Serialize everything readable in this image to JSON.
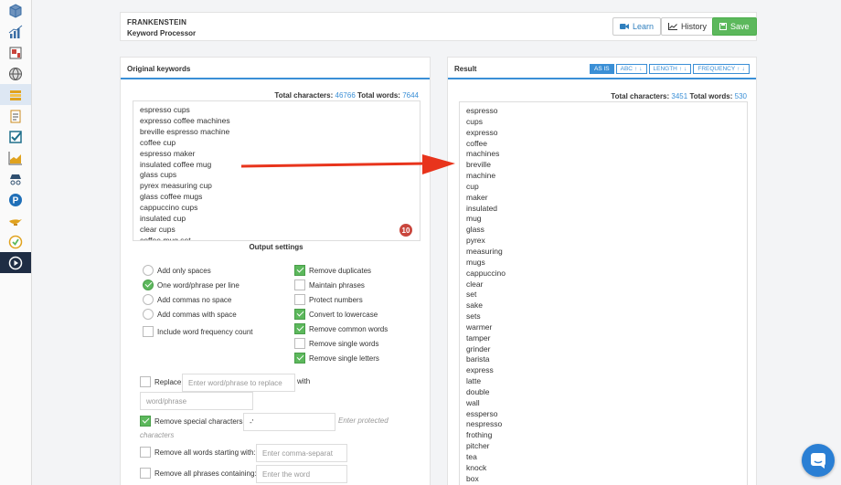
{
  "app_rail": [
    {
      "icon": "cube-icon",
      "color": "#3b6ea5"
    },
    {
      "icon": "bar-chart-icon",
      "color": "#3b6ea5"
    },
    {
      "icon": "report-icon",
      "color": "#c9463d"
    },
    {
      "icon": "globe-icon",
      "color": "#555555"
    },
    {
      "icon": "keyword-processor-icon",
      "color": "#e0a21e"
    },
    {
      "icon": "clipboard-icon",
      "color": "#c98a1e"
    },
    {
      "icon": "checklist-icon",
      "color": "#1f6f8b"
    },
    {
      "icon": "area-chart-icon",
      "color": "#e0a21e"
    },
    {
      "icon": "spy-icon",
      "color": "#2f4f6f"
    },
    {
      "icon": "parking-icon",
      "color": "#1f6fb8"
    },
    {
      "icon": "genie-lamp-icon",
      "color": "#e0a21e"
    },
    {
      "icon": "badge-check-icon",
      "color": "#e0a21e"
    },
    {
      "icon": "play-circle-icon",
      "color": "#ffffff"
    }
  ],
  "header": {
    "title": "FRANKENSTEIN",
    "subtitle": "Keyword Processor",
    "learn_label": "Learn",
    "history_label": "History",
    "save_label": "Save"
  },
  "original": {
    "panel_title": "Original keywords",
    "total_chars_label": "Total characters:",
    "total_chars": "46766",
    "total_words_label": "Total words:",
    "total_words": "7644",
    "keywords": [
      "espresso cups",
      "expresso coffee machines",
      "breville espresso machine",
      "coffee cup",
      "espresso maker",
      "insulated coffee mug",
      "glass cups",
      "pyrex measuring cup",
      "glass coffee mugs",
      "cappuccino cups",
      "insulated cup",
      "clear cups",
      "coffee mug set"
    ],
    "grammar_badge": "10"
  },
  "output_settings": {
    "title": "Output settings",
    "radios": [
      {
        "label": "Add only spaces",
        "checked": false
      },
      {
        "label": "One word/phrase per line",
        "checked": true
      },
      {
        "label": "Add commas no space",
        "checked": false
      },
      {
        "label": "Add commas with space",
        "checked": false
      }
    ],
    "freq_label": "Include word frequency count",
    "checkboxes": [
      {
        "label": "Remove duplicates",
        "checked": true
      },
      {
        "label": "Maintain phrases",
        "checked": false
      },
      {
        "label": "Protect numbers",
        "checked": false
      },
      {
        "label": "Convert to lowercase",
        "checked": true
      },
      {
        "label": "Remove common words",
        "checked": true
      },
      {
        "label": "Remove single words",
        "checked": false
      },
      {
        "label": "Remove single letters",
        "checked": true
      }
    ],
    "replace_label": "Replace",
    "replace_placeholder": "Enter word/phrase to replace",
    "with_label": "with",
    "with_placeholder": "word/phrase",
    "special_label": "Remove special characters:",
    "special_value": "-'",
    "protected_hint_1": "Enter protected",
    "protected_hint_2": "characters",
    "starting_label": "Remove all words starting with:",
    "starting_placeholder": "Enter comma-separat",
    "containing_label": "Remove all phrases containing:",
    "containing_placeholder": "Enter the word"
  },
  "result": {
    "panel_title": "Result",
    "sort": [
      {
        "label": "AS IS",
        "active": true,
        "arrows": false
      },
      {
        "label": "ABC",
        "active": false,
        "arrows": true
      },
      {
        "label": "LENGTH",
        "active": false,
        "arrows": true
      },
      {
        "label": "FREQUENCY",
        "active": false,
        "arrows": true
      }
    ],
    "total_chars_label": "Total characters:",
    "total_chars": "3451",
    "total_words_label": "Total words:",
    "total_words": "530",
    "words": [
      "espresso",
      "cups",
      "expresso",
      "coffee",
      "machines",
      "breville",
      "machine",
      "cup",
      "maker",
      "insulated",
      "mug",
      "glass",
      "pyrex",
      "measuring",
      "mugs",
      "cappuccino",
      "clear",
      "set",
      "sake",
      "sets",
      "warmer",
      "tamper",
      "grinder",
      "barista",
      "express",
      "latte",
      "double",
      "wall",
      "essperso",
      "nespresso",
      "frothing",
      "pitcher",
      "tea",
      "knock",
      "box"
    ]
  },
  "colors": {
    "accent": "#3a8fd6",
    "success": "#5cb85c",
    "arrow": "#e8341c",
    "chat": "#2a7fd4"
  }
}
